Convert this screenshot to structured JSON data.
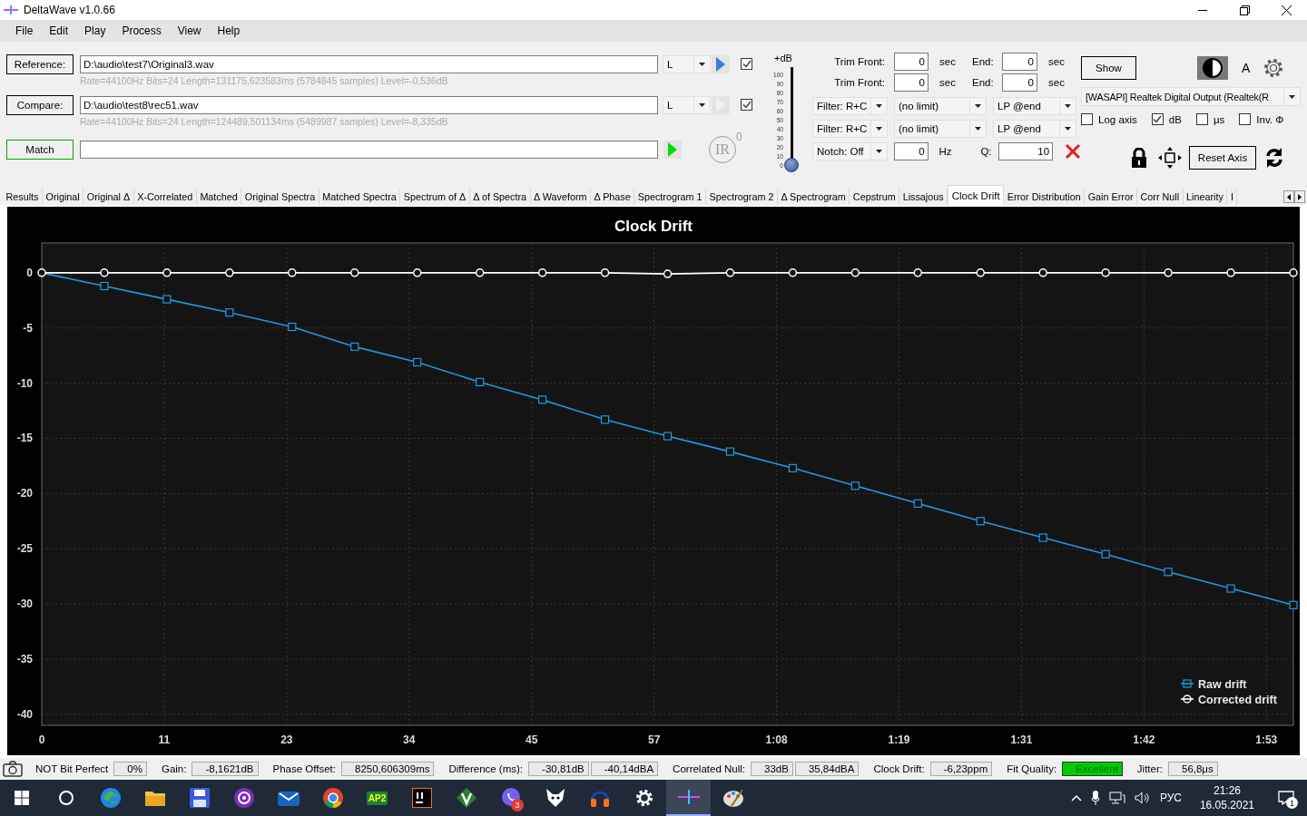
{
  "window": {
    "title": "DeltaWave v1.0.66"
  },
  "menu": [
    "File",
    "Edit",
    "Play",
    "Process",
    "View",
    "Help"
  ],
  "files": [
    {
      "button": "Reference:",
      "path": "D:\\audio\\test7\\Original3.wav",
      "info": "Rate=44100Hz Bits=24 Length=131175,623583ms (5784845 samples) Level=-0,536dB",
      "channel": "L",
      "play_enabled": true,
      "checked": true
    },
    {
      "button": "Compare:",
      "path": "D:\\audio\\test8\\rec51.wav",
      "info": "Rate=44100Hz Bits=24 Length=124489,501134ms (5489987 samples) Level=-8,335dB",
      "channel": "L",
      "play_enabled": false,
      "checked": true
    }
  ],
  "match": {
    "button": "Match",
    "ir_label": "IR",
    "ir_count": "0"
  },
  "gain_slider": {
    "label": "+dB",
    "scale": [
      "100",
      "90",
      "80",
      "70",
      "60",
      "50",
      "40",
      "30",
      "20",
      "10",
      "0"
    ],
    "level": 0
  },
  "trim": [
    {
      "label": "Trim Front:",
      "front": "0",
      "front_unit": "sec",
      "end_label": "End:",
      "end": "0",
      "end_unit": "sec"
    },
    {
      "label": "Trim Front:",
      "front": "0",
      "front_unit": "sec",
      "end_label": "End:",
      "end": "0",
      "end_unit": "sec"
    }
  ],
  "filters": [
    {
      "type": "Filter: R+C",
      "limit": "(no limit)",
      "mode": "LP @end"
    },
    {
      "type": "Filter: R+C",
      "limit": "(no limit)",
      "mode": "LP @end"
    }
  ],
  "notch": {
    "type": "Notch: Off",
    "freq": "0",
    "freq_unit": "Hz",
    "q_label": "Q:",
    "q": "10"
  },
  "show_button": "Show",
  "font_label": "A",
  "output_device": "[WASAPI] Realtek Digital Output (Realtek(R",
  "options": [
    {
      "label": "Log axis",
      "checked": false
    },
    {
      "label": "dB",
      "checked": true
    },
    {
      "label": "μs",
      "checked": false
    },
    {
      "label": "Inv. Φ",
      "checked": false
    }
  ],
  "reset_axis": "Reset Axis",
  "tabs": [
    {
      "label": "Results",
      "selected": false
    },
    {
      "label": "Original",
      "selected": false
    },
    {
      "label": "Original Δ",
      "selected": false
    },
    {
      "label": "X-Correlated",
      "selected": false
    },
    {
      "label": "Matched",
      "selected": false
    },
    {
      "label": "Original Spectra",
      "selected": false
    },
    {
      "label": "Matched Spectra",
      "selected": false
    },
    {
      "label": "Spectrum of Δ",
      "selected": false
    },
    {
      "label": "Δ of Spectra",
      "selected": false
    },
    {
      "label": "Δ Waveform",
      "selected": false
    },
    {
      "label": "Δ Phase",
      "selected": false
    },
    {
      "label": "Spectrogram 1",
      "selected": false
    },
    {
      "label": "Spectrogram 2",
      "selected": false
    },
    {
      "label": "Δ Spectrogram",
      "selected": false
    },
    {
      "label": "Cepstrum",
      "selected": false
    },
    {
      "label": "Lissajous",
      "selected": false
    },
    {
      "label": "Clock Drift",
      "selected": true
    },
    {
      "label": "Error Distribution",
      "selected": false
    },
    {
      "label": "Gain Error",
      "selected": false
    },
    {
      "label": "Corr Null",
      "selected": false
    },
    {
      "label": "Linearity",
      "selected": false
    },
    {
      "label": "I",
      "selected": false
    }
  ],
  "chart": {
    "chart_data": {
      "type": "line",
      "title": "Clock Drift",
      "grid": true,
      "legend": true,
      "x": [
        0,
        5.8,
        11.6,
        17.4,
        23.2,
        29,
        34.8,
        40.6,
        46.4,
        52.2,
        58,
        63.8,
        69.6,
        75.4,
        81.2,
        87,
        92.8,
        98.6,
        104.4,
        110.2,
        116
      ],
      "xlim": [
        0,
        116
      ],
      "ylim": [
        -41,
        2.7
      ],
      "xticks": [
        {
          "value": 0,
          "label": "0"
        },
        {
          "value": 11.35,
          "label": "11"
        },
        {
          "value": 22.7,
          "label": "23"
        },
        {
          "value": 34.05,
          "label": "34"
        },
        {
          "value": 45.4,
          "label": "45"
        },
        {
          "value": 56.75,
          "label": "57"
        },
        {
          "value": 68.1,
          "label": "1:08"
        },
        {
          "value": 79.45,
          "label": "1:19"
        },
        {
          "value": 90.8,
          "label": "1:31"
        },
        {
          "value": 102.15,
          "label": "1:42"
        },
        {
          "value": 113.5,
          "label": "1:53"
        }
      ],
      "yticks": [
        0,
        -5,
        -10,
        -15,
        -20,
        -25,
        -30,
        -35,
        -40
      ],
      "series": [
        {
          "name": "Raw drift",
          "color": "#1e9be0",
          "marker": "square",
          "values": [
            0,
            -1.2,
            -2.4,
            -3.6,
            -4.9,
            -6.7,
            -8.1,
            -9.9,
            -11.5,
            -13.3,
            -14.8,
            -16.2,
            -17.7,
            -19.3,
            -20.9,
            -22.5,
            -24,
            -25.5,
            -27.1,
            -28.6,
            -30.1
          ]
        },
        {
          "name": "Corrected drift",
          "color": "#ffffff",
          "marker": "circle",
          "values": [
            0,
            0,
            0,
            0,
            0,
            0,
            0,
            0,
            0,
            0,
            -0.1,
            0,
            0,
            0,
            0,
            0,
            0,
            0,
            0,
            0,
            0
          ]
        }
      ]
    }
  },
  "status_bar": {
    "items": [
      {
        "label": "NOT Bit Perfect",
        "values": [
          "0%"
        ],
        "highlighted": false
      },
      {
        "label": "Gain:",
        "values": [
          "-8,1621dB"
        ],
        "highlighted": false
      },
      {
        "label": "Phase Offset:",
        "values": [
          "8250,606309ms"
        ],
        "highlighted": false
      },
      {
        "label": "Difference (ms):",
        "values": [
          "-30,81dB",
          "-40,14dBA"
        ],
        "highlighted": false
      },
      {
        "label": "Correlated Null:",
        "values": [
          "33dB",
          "35,84dBA"
        ],
        "highlighted": false
      },
      {
        "label": "Clock Drift:",
        "values": [
          "-6,23ppm"
        ],
        "highlighted": false
      },
      {
        "label": "Fit Quality:",
        "values": [
          "Excellent"
        ],
        "highlighted": true
      },
      {
        "label": "Jitter:",
        "values": [
          "56,8μs"
        ],
        "highlighted": false
      }
    ]
  },
  "taskbar": {
    "apps": [
      {
        "kind": "search",
        "selected": false
      },
      {
        "kind": "browser",
        "selected": false
      },
      {
        "kind": "folder",
        "selected": false
      },
      {
        "kind": "floppy",
        "selected": false
      },
      {
        "kind": "podcast",
        "selected": false
      },
      {
        "kind": "mail",
        "selected": false
      },
      {
        "kind": "chrome",
        "selected": false
      },
      {
        "kind": "ap2",
        "label": "AP2",
        "selected": false
      },
      {
        "kind": "ide",
        "selected": false
      },
      {
        "kind": "vim",
        "selected": false
      },
      {
        "kind": "phone",
        "badge": "3",
        "selected": false
      },
      {
        "kind": "fox",
        "selected": false
      },
      {
        "kind": "headphones",
        "selected": false
      },
      {
        "kind": "gear",
        "selected": false
      },
      {
        "kind": "wave",
        "selected": true
      },
      {
        "kind": "paint",
        "selected": false
      }
    ],
    "language": "РУС",
    "time": "21:26",
    "date": "16.05.2021",
    "notification_count": "1"
  }
}
